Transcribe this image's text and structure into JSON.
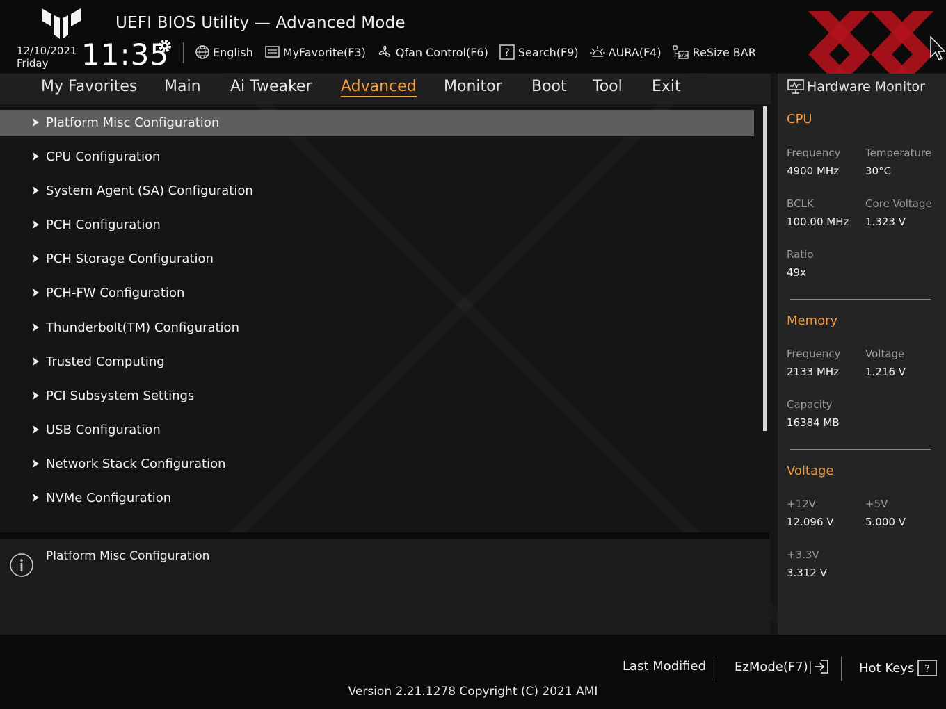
{
  "header": {
    "app_title": "UEFI BIOS Utility — Advanced Mode",
    "date": "12/10/2021",
    "day": "Friday",
    "time": "11:35",
    "toolbar": [
      {
        "label": "English",
        "icon": "globe-icon"
      },
      {
        "label": "MyFavorite(F3)",
        "icon": "favorite-icon"
      },
      {
        "label": "Qfan Control(F6)",
        "icon": "fan-icon"
      },
      {
        "label": "Search(F9)",
        "icon": "search-help-icon"
      },
      {
        "label": "AURA(F4)",
        "icon": "aura-light-icon"
      },
      {
        "label": "ReSize BAR",
        "icon": "resize-bar-icon"
      }
    ]
  },
  "tabs": [
    {
      "label": "My Favorites"
    },
    {
      "label": "Main"
    },
    {
      "label": "Ai Tweaker"
    },
    {
      "label": "Advanced",
      "active": true
    },
    {
      "label": "Monitor"
    },
    {
      "label": "Boot"
    },
    {
      "label": "Tool"
    },
    {
      "label": "Exit"
    }
  ],
  "menu": {
    "items": [
      {
        "label": "Platform Misc Configuration",
        "selected": true
      },
      {
        "label": "CPU Configuration"
      },
      {
        "label": "System Agent (SA) Configuration"
      },
      {
        "label": "PCH Configuration"
      },
      {
        "label": "PCH Storage Configuration"
      },
      {
        "label": "PCH-FW Configuration"
      },
      {
        "label": "Thunderbolt(TM) Configuration"
      },
      {
        "label": "Trusted Computing"
      },
      {
        "label": "PCI Subsystem Settings"
      },
      {
        "label": "USB Configuration"
      },
      {
        "label": "Network Stack Configuration"
      },
      {
        "label": "NVMe Configuration"
      }
    ]
  },
  "help": {
    "text": "Platform Misc Configuration"
  },
  "hardware_monitor": {
    "title": "Hardware Monitor",
    "cpu": {
      "heading": "CPU",
      "frequency_label": "Frequency",
      "frequency": "4900 MHz",
      "temperature_label": "Temperature",
      "temperature": "30°C",
      "bclk_label": "BCLK",
      "bclk": "100.00 MHz",
      "core_voltage_label": "Core Voltage",
      "core_voltage": "1.323 V",
      "ratio_label": "Ratio",
      "ratio": "49x"
    },
    "memory": {
      "heading": "Memory",
      "frequency_label": "Frequency",
      "frequency": "2133 MHz",
      "voltage_label": "Voltage",
      "voltage": "1.216 V",
      "capacity_label": "Capacity",
      "capacity": "16384 MB"
    },
    "voltage": {
      "heading": "Voltage",
      "v12_label": "+12V",
      "v12": "12.096 V",
      "v5_label": "+5V",
      "v5": "5.000 V",
      "v33_label": "+3.3V",
      "v33": "3.312 V"
    }
  },
  "footer": {
    "last_modified": "Last Modified",
    "ezmode": "EzMode(F7)|",
    "hot_keys": "Hot Keys",
    "version": "Version 2.21.1278 Copyright (C) 2021 AMI"
  },
  "colors": {
    "accent": "#f39c3c",
    "selected_row": "#5e5e5e",
    "watermark": "#b3121b"
  }
}
